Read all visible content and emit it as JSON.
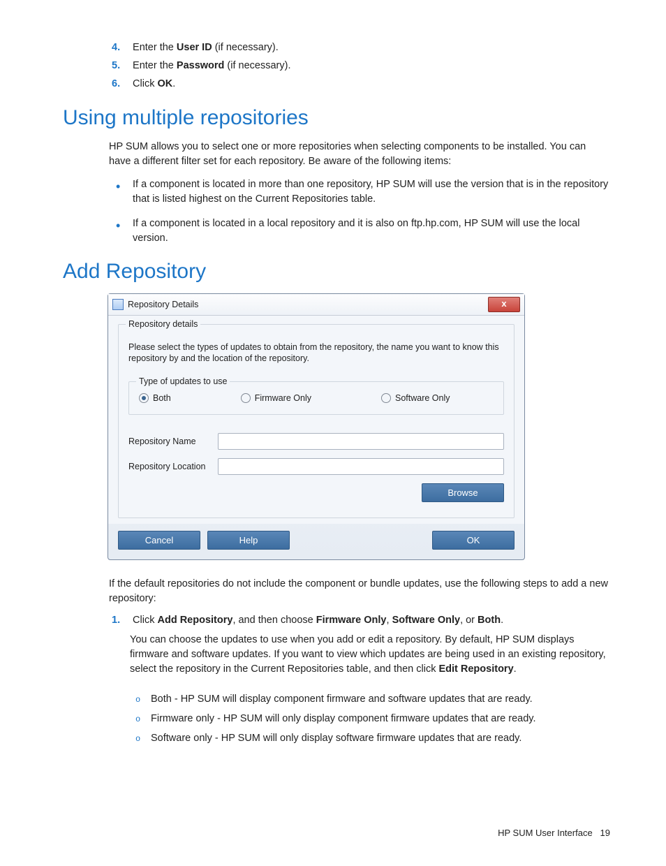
{
  "top_steps": {
    "s4": {
      "num": "4.",
      "pre": "Enter the ",
      "b": "User ID",
      "post": " (if necessary)."
    },
    "s5": {
      "num": "5.",
      "pre": "Enter the ",
      "b": "Password",
      "post": " (if necessary)."
    },
    "s6": {
      "num": "6.",
      "pre": "Click ",
      "b": "OK",
      "post": "."
    }
  },
  "sec1": {
    "heading": "Using multiple repositories",
    "p": "HP SUM allows you to select one or more repositories when selecting components to be installed. You can have a different filter set for each repository. Be aware of the following items:",
    "b1": "If a component is located in more than one repository, HP SUM will use the version that is in the repository that is listed highest on the Current Repositories table.",
    "b2": "If a component is located in a local repository and it is also on ftp.hp.com, HP SUM will use the local version."
  },
  "sec2": {
    "heading": "Add Repository"
  },
  "dialog": {
    "title": "Repository Details",
    "close": "x",
    "fs_legend": "Repository details",
    "desc": "Please select the types of updates to obtain from the repository, the name you want to know this repository by and the location of the repository.",
    "type_legend": "Type of updates to use",
    "r_both": "Both",
    "r_fw": "Firmware Only",
    "r_sw": "Software Only",
    "lbl_name": "Repository Name",
    "lbl_loc": "Repository Location",
    "btn_browse": "Browse",
    "btn_cancel": "Cancel",
    "btn_help": "Help",
    "btn_ok": "OK"
  },
  "after": {
    "p": "If the default repositories do not include the component or bundle updates, use the following steps to add a new repository:",
    "step1": {
      "num": "1.",
      "t1": "Click ",
      "b1": "Add Repository",
      "t2": ", and then choose ",
      "b2": "Firmware Only",
      "t3": ", ",
      "b3": "Software Only",
      "t4": ", or ",
      "b4": "Both",
      "t5": "."
    },
    "step1_p_a": "You can choose the updates to use when you add or edit a repository. By default, HP SUM displays firmware and software updates. If you want to view which updates are being used in an existing repository, select the repository in the Current Repositories table, and then click ",
    "step1_p_bold": "Edit Repository",
    "step1_p_b": ".",
    "sub1": "Both - HP SUM will display component firmware and software updates that are ready.",
    "sub2": "Firmware only - HP SUM will only display component firmware updates that are ready.",
    "sub3": "Software only - HP SUM will only display software firmware updates that are ready."
  },
  "footer": {
    "left": "HP SUM User Interface",
    "page": "19"
  }
}
